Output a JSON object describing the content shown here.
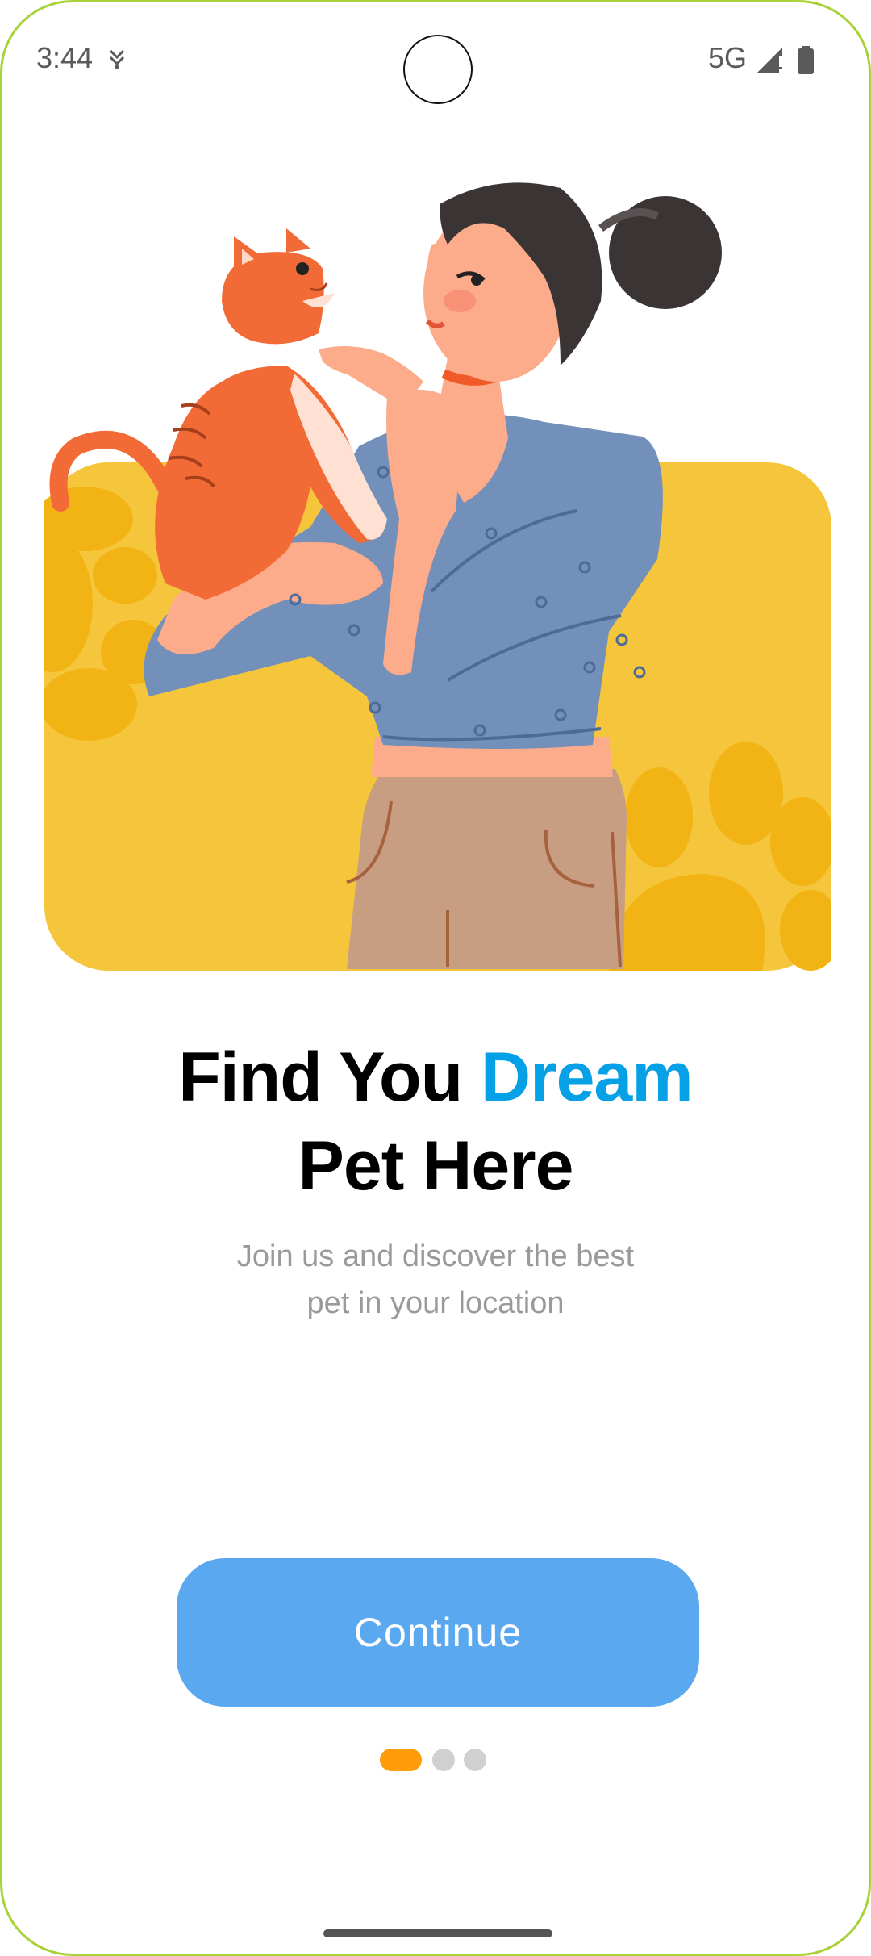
{
  "status_bar": {
    "time": "3:44",
    "network": "5G",
    "icons": [
      "location-arrow-icon",
      "signal-icon",
      "battery-icon"
    ]
  },
  "onboarding": {
    "title_part1": "Find You ",
    "title_accent": "Dream",
    "title_line2": "Pet Here",
    "subtitle_line1": "Join us and discover the best",
    "subtitle_line2": "pet in your location",
    "continue_label": "Continue",
    "page_indicator": {
      "current": 1,
      "total": 3
    }
  },
  "colors": {
    "accent": "#06a0e6",
    "button": "#5aa8ef",
    "indicator_active": "#ff9c0a",
    "indicator_inactive": "#d0d0d0",
    "illustration_bg": "#f5c63b"
  }
}
